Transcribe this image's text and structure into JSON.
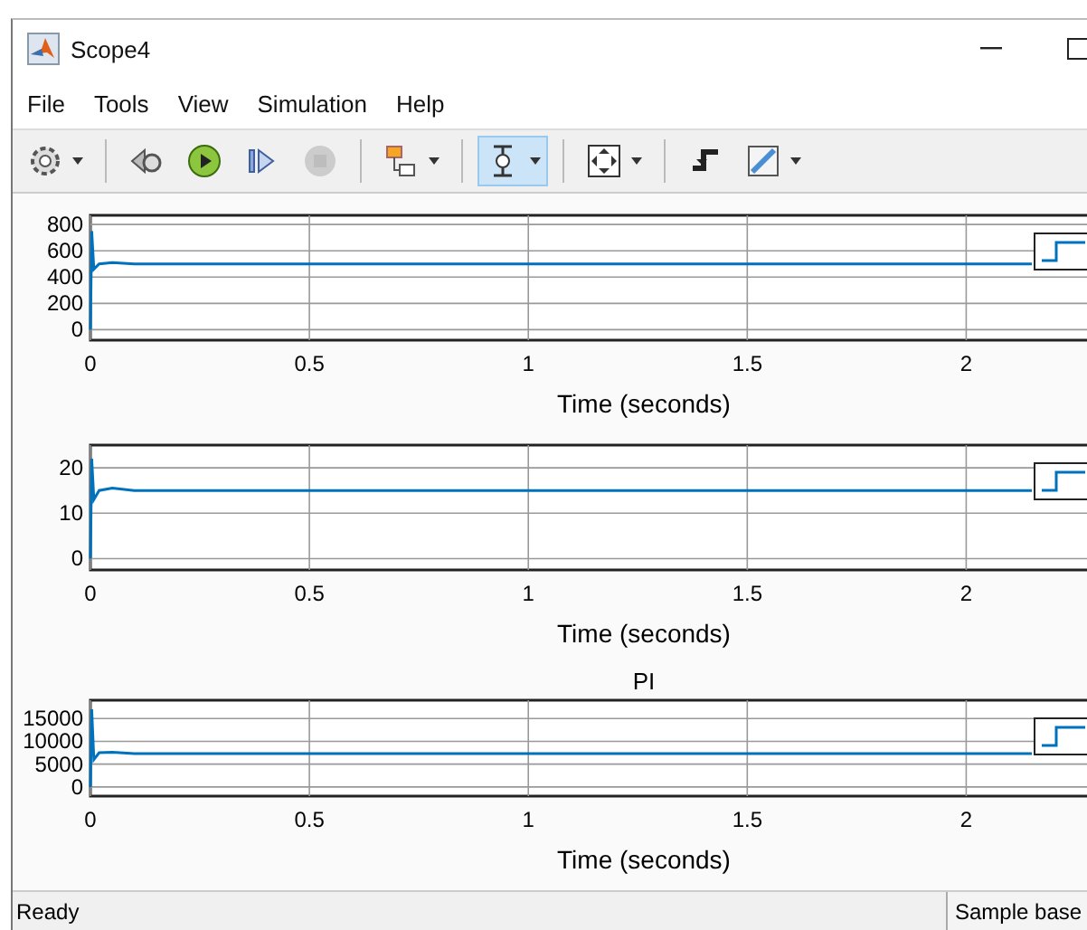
{
  "window": {
    "title": "Scope4"
  },
  "menu": [
    {
      "label": "File"
    },
    {
      "label": "Tools"
    },
    {
      "label": "View"
    },
    {
      "label": "Simulation"
    },
    {
      "label": "Help"
    }
  ],
  "toolbar": [
    {
      "kind": "settings",
      "dropdown": true,
      "selected": false,
      "disabled": false
    },
    {
      "kind": "sep"
    },
    {
      "kind": "step-back",
      "dropdown": false,
      "selected": false,
      "disabled": false
    },
    {
      "kind": "run",
      "dropdown": false,
      "selected": false,
      "disabled": false
    },
    {
      "kind": "step-forward",
      "dropdown": false,
      "selected": false,
      "disabled": false
    },
    {
      "kind": "stop",
      "dropdown": false,
      "selected": false,
      "disabled": true
    },
    {
      "kind": "sep"
    },
    {
      "kind": "highlight",
      "dropdown": true,
      "selected": false,
      "disabled": false
    },
    {
      "kind": "sep"
    },
    {
      "kind": "zoom",
      "dropdown": true,
      "selected": true,
      "disabled": false
    },
    {
      "kind": "sep"
    },
    {
      "kind": "fit",
      "dropdown": true,
      "selected": false,
      "disabled": false
    },
    {
      "kind": "sep"
    },
    {
      "kind": "trigger",
      "dropdown": false,
      "selected": false,
      "disabled": false
    },
    {
      "kind": "measure",
      "dropdown": true,
      "selected": false,
      "disabled": false
    }
  ],
  "plots": [
    {
      "chart_data": {
        "type": "line",
        "grid": true,
        "xlabel": "Time (seconds)",
        "x": [
          0,
          0.003,
          0.008,
          0.02,
          0.05,
          0.1,
          2.15
        ],
        "series": [
          {
            "color": "#0072bd",
            "values": [
              0,
              750,
              460,
              500,
              510,
              500,
              500
            ]
          }
        ],
        "xlim": [
          0,
          2.28
        ],
        "ylim": [
          -80,
          870
        ],
        "xticks": [
          0,
          0.5,
          1,
          1.5,
          2
        ],
        "yticks": [
          0,
          200,
          400,
          600,
          800
        ]
      }
    },
    {
      "chart_data": {
        "type": "line",
        "grid": true,
        "xlabel": "Time (seconds)",
        "x": [
          0,
          0.003,
          0.008,
          0.02,
          0.05,
          0.1,
          2.15
        ],
        "series": [
          {
            "color": "#0072bd",
            "values": [
              0,
              22,
              13,
              15,
              15.5,
              15,
              15
            ]
          }
        ],
        "xlim": [
          0,
          2.28
        ],
        "ylim": [
          -2.5,
          25
        ],
        "xticks": [
          0,
          0.5,
          1,
          1.5,
          2
        ],
        "yticks": [
          0,
          10,
          20
        ]
      }
    },
    {
      "chart_data": {
        "type": "line",
        "grid": true,
        "title": "PI",
        "xlabel": "Time (seconds)",
        "x": [
          0,
          0.003,
          0.008,
          0.02,
          0.05,
          0.1,
          2.15
        ],
        "series": [
          {
            "color": "#0072bd",
            "values": [
              0,
              17000,
              6000,
              7500,
              7600,
              7300,
              7300
            ]
          }
        ],
        "xlim": [
          0,
          2.28
        ],
        "ylim": [
          -2000,
          19000
        ],
        "xticks": [
          0,
          0.5,
          1,
          1.5,
          2
        ],
        "yticks": [
          0,
          5000,
          10000,
          15000
        ]
      }
    }
  ],
  "status_bar": {
    "status": "Ready",
    "mode": "Sample base"
  }
}
